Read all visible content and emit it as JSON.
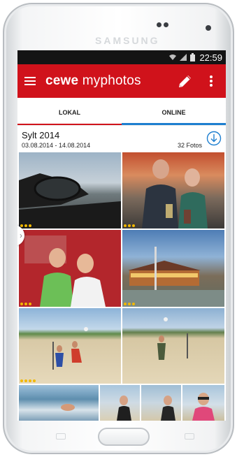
{
  "device": {
    "brand": "SAMSUNG"
  },
  "status_bar": {
    "time": "22:59",
    "icons": [
      "wifi-icon",
      "signal-icon",
      "battery-icon"
    ]
  },
  "app_bar": {
    "logo_bold": "cewe",
    "logo_light": " myphotos",
    "icons": [
      "menu-icon",
      "pencil-icon",
      "more-vertical-icon"
    ],
    "color": "#d0121b"
  },
  "tabs": [
    {
      "label": "LOKAL",
      "active": false,
      "indicator_color": "#d0121b"
    },
    {
      "label": "ONLINE",
      "active": true,
      "indicator_color": "#1e7fd0"
    }
  ],
  "album": {
    "title": "Sylt 2014",
    "dates": "03.08.2014 - 14.08.2014",
    "count": "32 Fotos",
    "download_icon": "download-circle-icon"
  },
  "photos": [
    {
      "name": "photo-car-mirror-beach",
      "rating_dots": 3
    },
    {
      "name": "photo-two-men-restaurant",
      "rating_dots": 3
    },
    {
      "name": "photo-couple-red-wall",
      "rating_dots": 3
    },
    {
      "name": "photo-promenade-building",
      "rating_dots": 3
    },
    {
      "name": "photo-beach-volleyball-1",
      "rating_dots": 4
    },
    {
      "name": "photo-beach-volleyball-2",
      "rating_dots": 0
    },
    {
      "name": "photo-surf-water",
      "rating_dots": 0
    },
    {
      "name": "photo-man-beach-1",
      "rating_dots": 0
    },
    {
      "name": "photo-man-beach-2",
      "rating_dots": 0
    },
    {
      "name": "photo-woman-sunglasses",
      "rating_dots": 0
    }
  ],
  "accent_colors": {
    "rating_dot": "#f2b800",
    "status_bar": "#141414"
  }
}
